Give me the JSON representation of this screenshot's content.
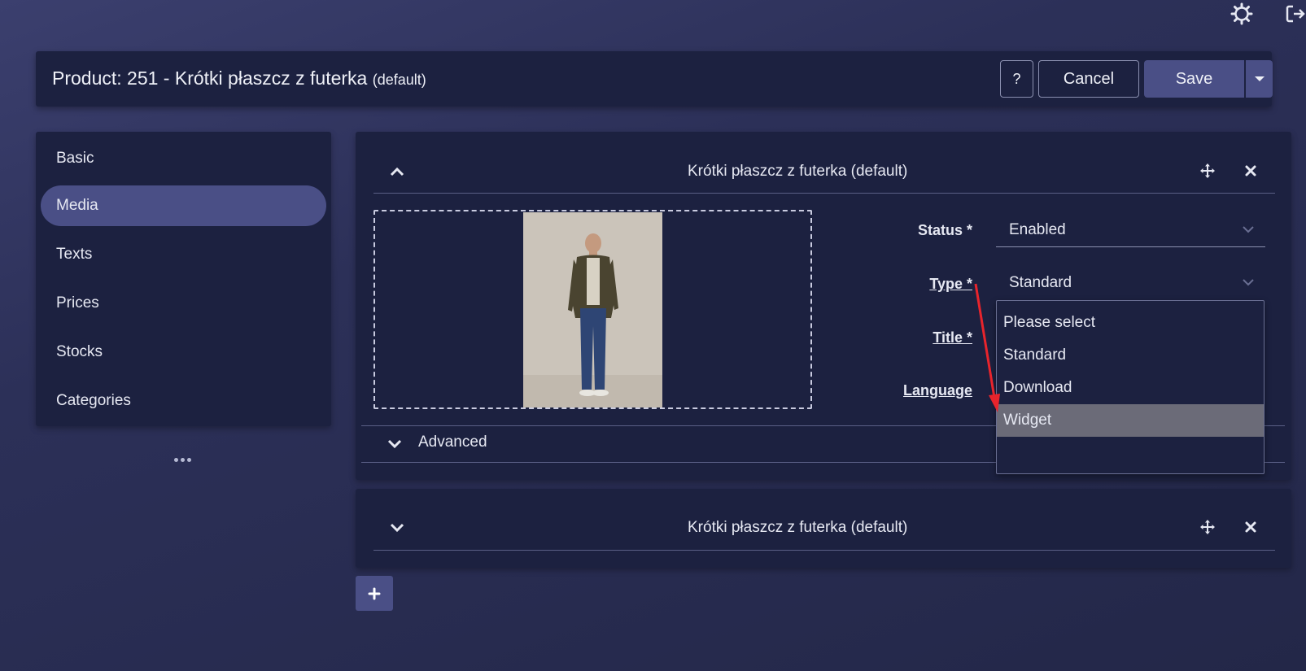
{
  "header": {
    "title_main": "Product: 251 - Krótki płaszcz z futerka",
    "title_suffix": "(default)",
    "help_label": "?",
    "cancel_label": "Cancel",
    "save_label": "Save"
  },
  "top_icons": [
    "gear-icon",
    "logout-icon"
  ],
  "sidebar": {
    "items": [
      {
        "label": "Basic",
        "active": false
      },
      {
        "label": "Media",
        "active": true
      },
      {
        "label": "Texts",
        "active": false
      },
      {
        "label": "Prices",
        "active": false
      },
      {
        "label": "Stocks",
        "active": false
      },
      {
        "label": "Categories",
        "active": false
      }
    ]
  },
  "media_items": [
    {
      "title": "Krótki płaszcz z futerka (default)",
      "expanded": true,
      "fields": {
        "status": {
          "label": "Status *",
          "value": "Enabled"
        },
        "type": {
          "label": "Type *",
          "value": "Standard"
        },
        "title": {
          "label": "Title *"
        },
        "language": {
          "label": "Language"
        }
      },
      "type_options": [
        "Please select",
        "Standard",
        "Download",
        "Widget"
      ],
      "highlighted_option": "Widget",
      "advanced_label": "Advanced"
    },
    {
      "title": "Krótki płaszcz z futerka (default)",
      "expanded": false
    }
  ],
  "colors": {
    "panel": "#1c2140",
    "accent": "#4a4f86",
    "highlight": "#6b6b78",
    "annotation_arrow": "#e8242c"
  }
}
